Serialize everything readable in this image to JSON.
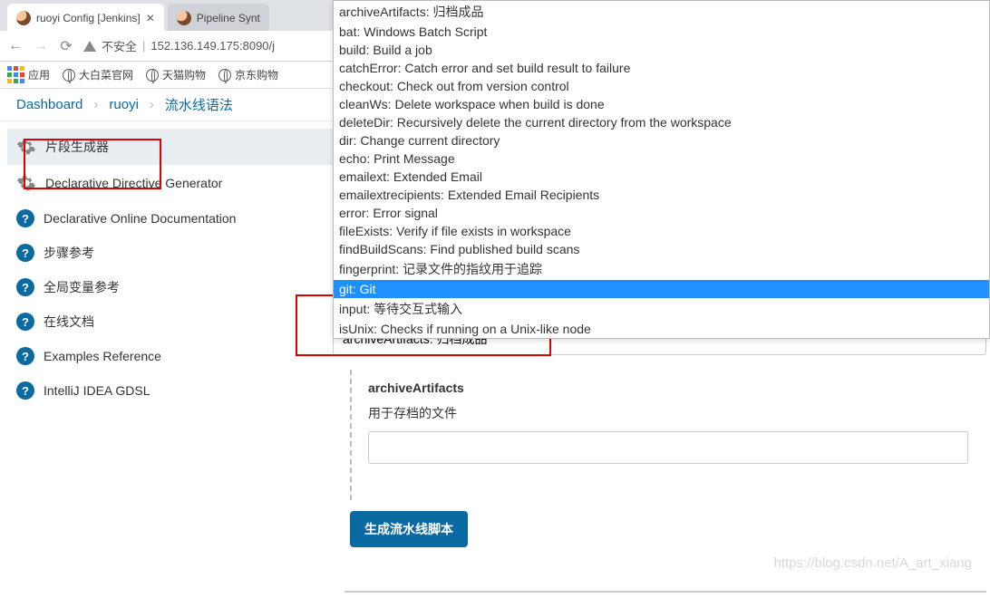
{
  "browser": {
    "tabs": [
      {
        "title": "ruoyi Config [Jenkins]"
      },
      {
        "title": "Pipeline Synt"
      }
    ],
    "insecure_label": "不安全",
    "url": "152.136.149.175:8090/j",
    "apps_label": "应用",
    "bookmarks": [
      "大白菜官网",
      "天猫购物",
      "京东购物"
    ]
  },
  "crumbs": {
    "dashboard": "Dashboard",
    "project": "ruoyi",
    "page": "流水线语法"
  },
  "sidebar": {
    "items": [
      {
        "label": "片段生成器",
        "icon": "gear",
        "active": true
      },
      {
        "label": "Declarative Directive Generator",
        "icon": "gear"
      },
      {
        "label": "Declarative Online Documentation",
        "icon": "help"
      },
      {
        "label": "步骤参考",
        "icon": "help"
      },
      {
        "label": "全局变量参考",
        "icon": "help"
      },
      {
        "label": "在线文档",
        "icon": "help"
      },
      {
        "label": "Examples Reference",
        "icon": "help"
      },
      {
        "label": "IntelliJ IDEA GDSL",
        "icon": "help"
      }
    ]
  },
  "dropdown": {
    "options": [
      "archiveArtifacts: 归档成品",
      "bat: Windows Batch Script",
      "build: Build a job",
      "catchError: Catch error and set build result to failure",
      "checkout: Check out from version control",
      "cleanWs: Delete workspace when build is done",
      "deleteDir: Recursively delete the current directory from the workspace",
      "dir: Change current directory",
      "echo: Print Message",
      "emailext: Extended Email",
      "emailextrecipients: Extended Email Recipients",
      "error: Error signal",
      "fileExists: Verify if file exists in workspace",
      "findBuildScans: Find published build scans",
      "fingerprint: 记录文件的指纹用于追踪",
      "git: Git",
      "input: 等待交互式输入",
      "isUnix: Checks if running on a Unix-like node"
    ],
    "highlighted_index": 15
  },
  "main": {
    "combo_value": "archiveArtifacts: 归档成品",
    "section_title": "archiveArtifacts",
    "file_label": "用于存档的文件",
    "file_value": "",
    "generate_button": "生成流水线脚本"
  },
  "watermark": "https://blog.csdn.net/A_art_xiang"
}
